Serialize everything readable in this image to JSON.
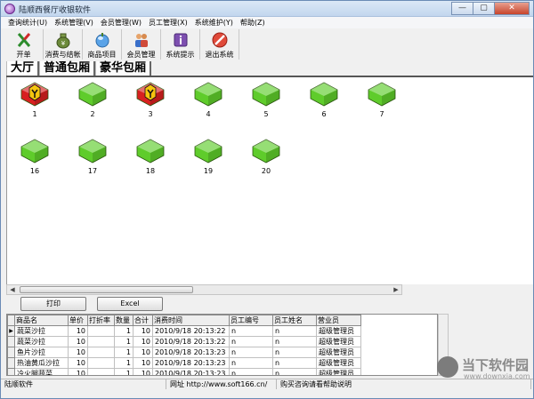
{
  "window": {
    "title": "陆顺西餐厅收银软件",
    "controls": [
      "—",
      "▢",
      "✕"
    ]
  },
  "menu": [
    "查询统计(U)",
    "系统管理(V)",
    "会员管理(W)",
    "员工管理(X)",
    "系统维护(Y)",
    "帮助(Z)"
  ],
  "toolbar": [
    {
      "label": "开单",
      "icon": "open-order-icon"
    },
    {
      "label": "消费与结帐",
      "icon": "money-bag-icon"
    },
    {
      "label": "商品项目",
      "icon": "products-icon"
    },
    {
      "label": "会员管理",
      "icon": "members-icon"
    },
    {
      "label": "系统提示",
      "icon": "info-icon"
    },
    {
      "label": "退出系统",
      "icon": "exit-icon"
    }
  ],
  "tabs": [
    "大厅",
    "普通包厢",
    "豪华包厢"
  ],
  "rooms": [
    {
      "number": "1",
      "status": "occupied"
    },
    {
      "number": "2",
      "status": "free"
    },
    {
      "number": "3",
      "status": "occupied"
    },
    {
      "number": "4",
      "status": "free"
    },
    {
      "number": "5",
      "status": "free"
    },
    {
      "number": "6",
      "status": "free"
    },
    {
      "number": "7",
      "status": "free"
    },
    {
      "number": "16",
      "status": "free"
    },
    {
      "number": "17",
      "status": "free"
    },
    {
      "number": "18",
      "status": "free"
    },
    {
      "number": "19",
      "status": "free"
    },
    {
      "number": "20",
      "status": "free"
    }
  ],
  "buttons": {
    "print": "打印",
    "excel": "Excel"
  },
  "grid": {
    "columns": [
      "商品名",
      "单价",
      "打折率",
      "数量",
      "合计",
      "消费时间",
      "员工编号",
      "员工姓名",
      "营业员"
    ],
    "rows": [
      [
        "蔬菜沙拉",
        "10",
        "",
        "1",
        "10",
        "2010/9/18 20:13:22",
        "n",
        "n",
        "超级管理员"
      ],
      [
        "蔬菜沙拉",
        "10",
        "",
        "1",
        "10",
        "2010/9/18 20:13:22",
        "n",
        "n",
        "超级管理员"
      ],
      [
        "鱼片沙拉",
        "10",
        "",
        "1",
        "10",
        "2010/9/18 20:13:23",
        "n",
        "n",
        "超级管理员"
      ],
      [
        "热油黄瓜沙拉",
        "10",
        "",
        "1",
        "10",
        "2010/9/18 20:13:23",
        "n",
        "n",
        "超级管理员"
      ],
      [
        "冷火腿蔬菜",
        "10",
        "",
        "1",
        "10",
        "2010/9/18 20:13:23",
        "n",
        "n",
        "超级管理员"
      ]
    ]
  },
  "status": {
    "app": "陆顺软件",
    "url": "网址 http://www.soft166.cn/",
    "help": "购买咨询请看帮助说明"
  },
  "watermark": {
    "big": "当下软件园",
    "small": "www.downxia.com"
  },
  "colors": {
    "free": "#5fcc2b",
    "occupied": "#d82020",
    "accent": "#6a8bb5"
  }
}
